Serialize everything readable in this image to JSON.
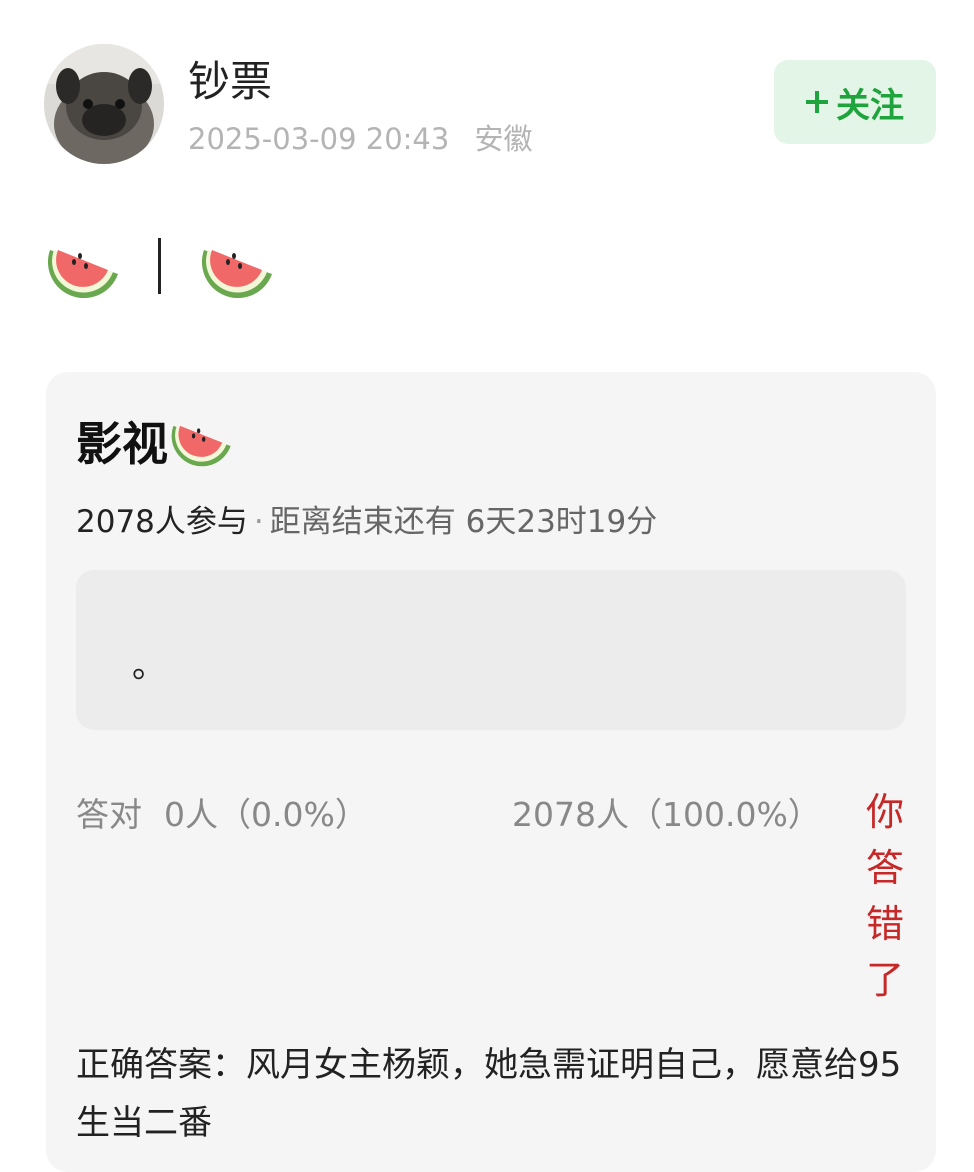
{
  "post": {
    "author": {
      "name": "钞票",
      "avatar_icon": "pug-avatar"
    },
    "timestamp": "2025-03-09 20:43",
    "location": "安徽",
    "follow_label": "关注",
    "follow_icon": "plus-icon",
    "content_icons": [
      "watermelon-icon",
      "watermelon-icon"
    ]
  },
  "quiz": {
    "title": "影视",
    "title_icon": "watermelon-icon",
    "participants": "2078人参与",
    "separator": "·",
    "countdown": "距离结束还有 6天23时19分",
    "option_text": "。",
    "correct": {
      "label": "答对",
      "value": "0人（0.0%）"
    },
    "wrong": {
      "value": "2078人（100.0%）",
      "label": "你答错了"
    },
    "answer": "正确答案：风月女主杨颖，她急需证明自己，愿意给95生当二番"
  },
  "colors": {
    "follow_bg": "#e3f5e6",
    "follow_text": "#1fa33c",
    "wrong_text": "#c62828",
    "card_bg": "#f5f5f5",
    "meta_text": "#b4b4b4"
  }
}
